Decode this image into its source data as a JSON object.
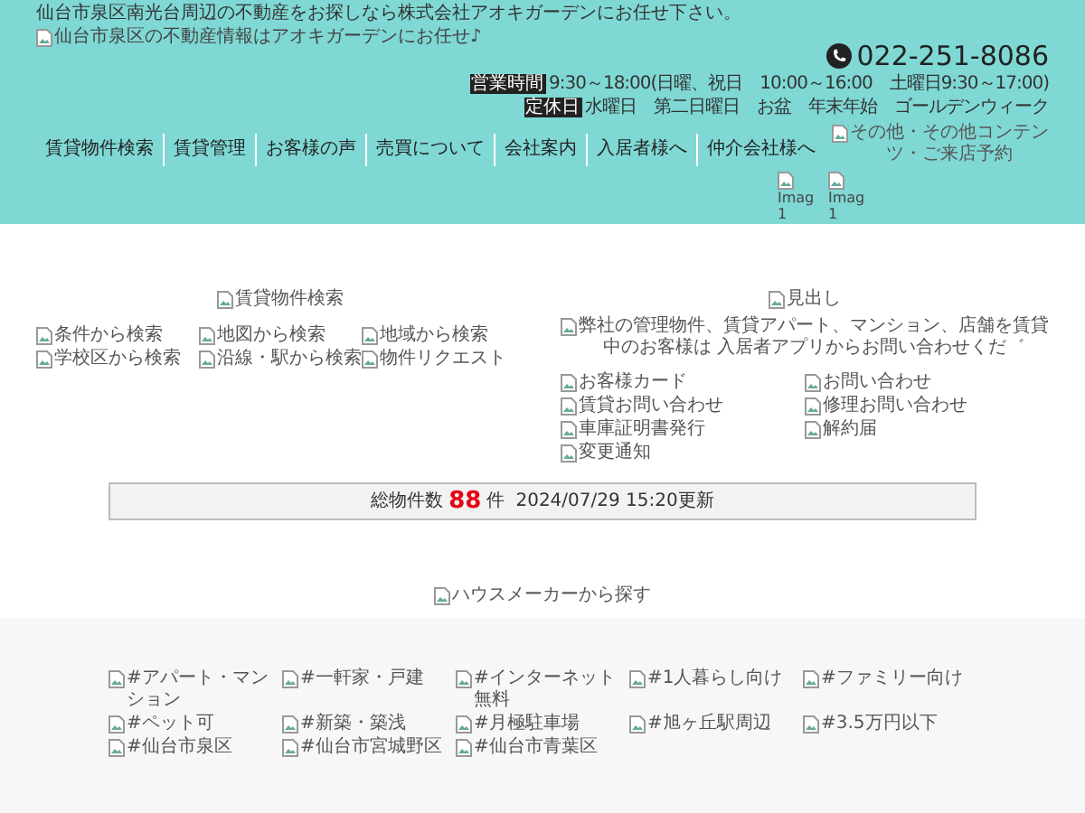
{
  "header": {
    "tagline": "仙台市泉区南光台周辺の不動産をお探しなら株式会社アオキガーデンにお任せ下さい。",
    "logo_alt": "仙台市泉区の不動産情報はアオキガーデンにお任せ♪",
    "phone": "022-251-8086",
    "hours": {
      "badge": "営業時間",
      "text": "9:30～18:00(日曜、祝日　10:00～16:00　土曜日9:30～17:00)"
    },
    "holidays": {
      "badge": "定休日",
      "text": "水曜日　第二日曜日　お盆　年末年始　ゴールデンウィーク"
    },
    "nav": [
      "賃貸物件検索",
      "賃貸管理",
      "お客様の声",
      "売買について",
      "会社案内",
      "入居者様へ",
      "仲介会社様へ"
    ],
    "other_alt": "その他・その他コンテンツ・ご来店予約",
    "images": [
      "Imag 1",
      "Imag 1"
    ]
  },
  "search": {
    "title": "賃貸物件検索",
    "links": [
      "条件から検索",
      "地図から検索",
      "地域から検索",
      "学校区から検索",
      "沿線・駅から検索",
      "物件リクエスト"
    ]
  },
  "notice": {
    "title": "見出し",
    "message": "弊社の管理物件、賃貸アパート、マンション、店舗を賃貸中のお客様は 入居者アプリからお問い合わせくだ゛",
    "links": [
      "お客様カード",
      "お問い合わせ",
      "賃貸お問い合わせ",
      "修理お問い合わせ",
      "車庫証明書発行",
      "解約届",
      "変更通知"
    ]
  },
  "counter": {
    "label": "総物件数",
    "count": "88",
    "unit": "件",
    "updated": "2024/07/29 15:20更新"
  },
  "house_maker": "ハウスメーカーから探す",
  "tags": [
    "#アパート・マンション",
    "#一軒家・戸建",
    "#インターネット無料",
    "#1人暮らし向け",
    "#ファミリー向け",
    "#ペット可",
    "#新築・築浅",
    "#月極駐車場",
    "#旭ヶ丘駅周辺",
    "#3.5万円以下",
    "#仙台市泉区",
    "#仙台市宮城野区",
    "#仙台市青葉区"
  ]
}
